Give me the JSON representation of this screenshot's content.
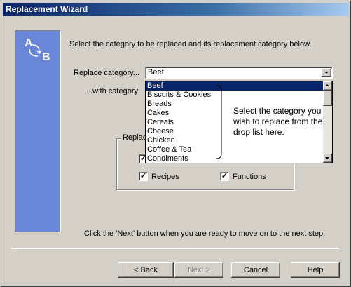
{
  "window": {
    "title": "Replacement Wizard"
  },
  "logo": {
    "letter_a": "A",
    "letter_b": "B"
  },
  "instructions": "Select the category to be replaced and its replacement category below.",
  "replace": {
    "label": "Replace category...",
    "value": "Beef"
  },
  "with": {
    "label": "...with category"
  },
  "dropdown": {
    "items": [
      "Beef",
      "Biscuits & Cookies",
      "Breads",
      "Cakes",
      "Cereals",
      "Cheese",
      "Chicken",
      "Coffee & Tea",
      "Condiments"
    ],
    "selected_index": 0
  },
  "callout": {
    "text": "Select the category you wish to replace from the drop list here."
  },
  "group": {
    "label": "Replac",
    "recipes_label": "Recipes",
    "functions_label": "Functions",
    "recipes_checked": true,
    "functions_checked": true,
    "hidden_checkbox_checked": true
  },
  "footer_hint": "Click the 'Next' button when you are ready to move on to the next step.",
  "buttons": {
    "back": "< Back",
    "next": "Next >",
    "cancel": "Cancel",
    "help": "Help"
  },
  "colors": {
    "title_start": "#0a246a",
    "title_end": "#a6caf0",
    "side_panel": "#6a86d8",
    "selection": "#0a246a"
  }
}
